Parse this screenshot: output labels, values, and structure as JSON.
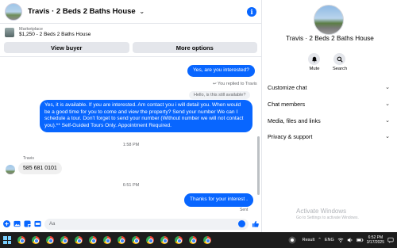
{
  "chat": {
    "title": "Travis · 2 Beds 2 Baths House",
    "marketplace_label": "Marketplace",
    "listing": "$1,250 - 2 Beds 2 Baths House",
    "view_buyer": "View buyer",
    "more_options": "More options"
  },
  "messages": {
    "out1": "Yes, are you interested?",
    "reply_note": "You replied to Travis",
    "reply_quote": "Hello, is this still available?",
    "out2": "Yes, it is available. If you are interested.  Am contact you i will detail you.  When would be a good time for you to come and view the property? Send your number We can I schedule a tour.  Don't forget to send your number (Without number we will not contact you).** Self-Guided Tours Only. Appointment Required.",
    "time1": "1:58 PM",
    "sender": "Travis",
    "in1": "585 681 0101",
    "time2": "6:51 PM",
    "out3": "Thanks for your interest .",
    "sent": "Sent"
  },
  "composer": {
    "placeholder": "Aa"
  },
  "details": {
    "title": "Travis · 2 Beds 2 Baths House",
    "mute": "Mute",
    "search": "Search",
    "sections": [
      "Customize chat",
      "Chat members",
      "Media, files and links",
      "Privacy & support"
    ],
    "activate_1": "Activate Windows",
    "activate_2": "Go to Settings to activate Windows."
  },
  "taskbar": {
    "result": "Result",
    "lang": "ENG",
    "time": "6:52 PM",
    "date": "3/17/2025"
  },
  "colors": {
    "accent": "#0866ff",
    "bubble_in": "#f0f0f0",
    "taskbar": "#1d1d1d"
  }
}
